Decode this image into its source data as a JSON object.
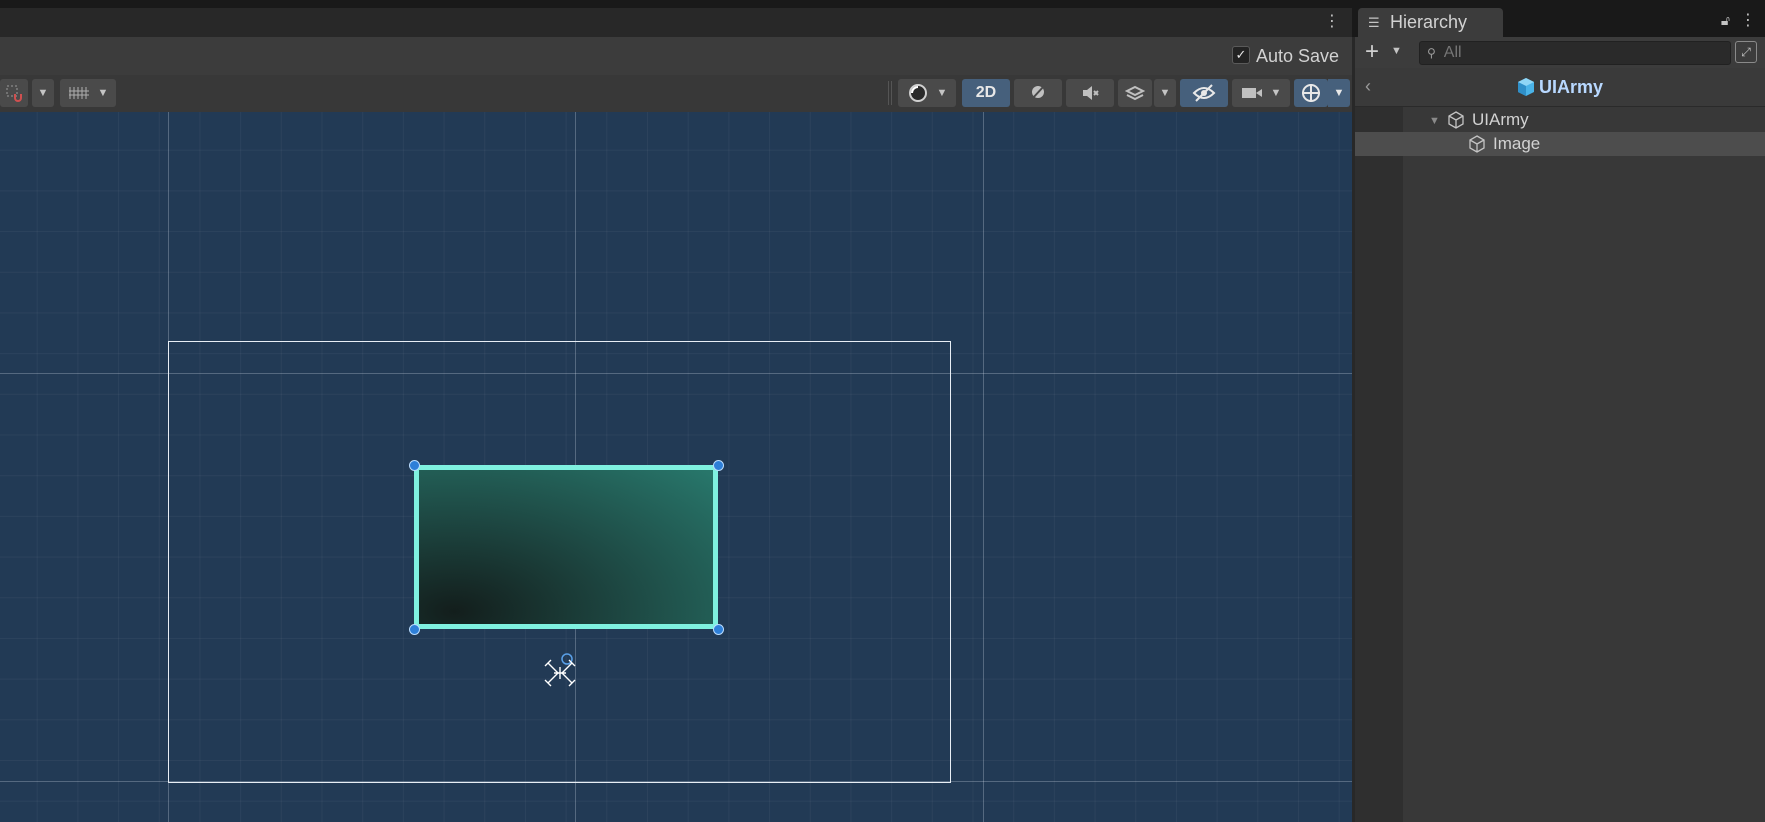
{
  "scene": {
    "menu_icon": "kebab-menu-icon",
    "auto_save": {
      "label": "Auto Save",
      "checked": true
    },
    "toolbar": {
      "snap_icon": "grid-snap-icon",
      "grid_icon": "grid-visibility-icon",
      "draw_mode_icon": "shading-mode-icon",
      "mode_2d_label": "2D",
      "lighting_icon": "lighting-icon",
      "audio_icon": "audio-mute-icon",
      "effects_icon": "effects-icon",
      "visibility_icon": "hidden-objects-icon",
      "camera_icon": "camera-icon",
      "gizmos_icon": "gizmos-icon"
    },
    "viewport": {
      "background": "#223a55",
      "image_border": "#7ff1e0",
      "handle_color": "#2e7fd8"
    }
  },
  "hierarchy": {
    "tab_label": "Hierarchy",
    "tab_icon": "list-icon",
    "search": {
      "placeholder": "All"
    },
    "breadcrumb": {
      "label": "UIArmy",
      "icon": "prefab-cube-icon"
    },
    "items": [
      {
        "label": "UIArmy",
        "depth": 0,
        "expanded": true,
        "selected": false,
        "icon": "gameobject-icon"
      },
      {
        "label": "Image",
        "depth": 1,
        "expanded": false,
        "selected": true,
        "icon": "gameobject-icon"
      }
    ]
  }
}
